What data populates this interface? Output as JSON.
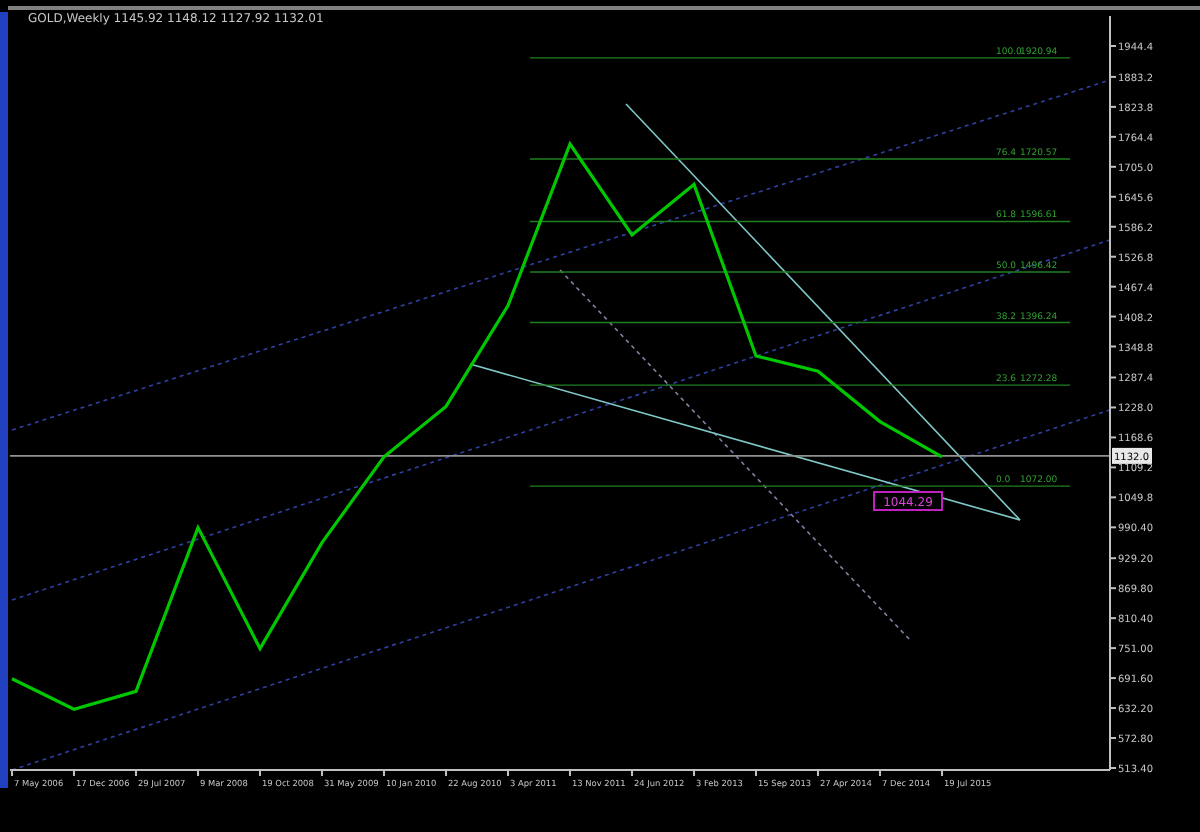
{
  "chart": {
    "title": "GOLD,Weekly  1145.92 1148.12 1127.92 1132.01",
    "price_label": "1132.0",
    "low_label": "1044.29",
    "fib_levels": [
      {
        "ratio": "100.0",
        "price": "1920.94"
      },
      {
        "ratio": "76.4",
        "price": "1720.57"
      },
      {
        "ratio": "61.8",
        "price": "1596.61"
      },
      {
        "ratio": "50.0",
        "price": "1496.42"
      },
      {
        "ratio": "38.2",
        "price": "1396.24"
      },
      {
        "ratio": "23.6",
        "price": "1272.28"
      },
      {
        "ratio": "0.0",
        "price": "1072.00"
      }
    ],
    "chart_data": {
      "type": "line",
      "categories": [
        "7 May 2006",
        "17 Dec 2006",
        "29 Jul 2007",
        "9 Mar 2008",
        "19 Oct 2008",
        "31 May 2009",
        "10 Jan 2010",
        "22 Aug 2010",
        "3 Apr 2011",
        "13 Nov 2011",
        "24 Jun 2012",
        "3 Feb 2013",
        "15 Sep 2013",
        "27 Apr 2014",
        "7 Dec 2014",
        "19 Jul 2015"
      ],
      "series": [
        {
          "color": "#00c800",
          "values": [
            690,
            630,
            665,
            990,
            750,
            960,
            1130,
            1230,
            1430,
            1750,
            1570,
            1670,
            1330,
            1300,
            1200,
            1130
          ]
        }
      ],
      "ylim": [
        509.4,
        2003.9
      ],
      "yticks": [
        {
          "value": 1944.4,
          "label": "1944.4"
        },
        {
          "value": 1883.2,
          "label": "1883.2"
        },
        {
          "value": 1823.8,
          "label": "1823.8"
        },
        {
          "value": 1764.4,
          "label": "1764.4"
        },
        {
          "value": 1705.0,
          "label": "1705.0"
        },
        {
          "value": 1645.6,
          "label": "1645.6"
        },
        {
          "value": 1586.2,
          "label": "1586.2"
        },
        {
          "value": 1526.8,
          "label": "1526.8"
        },
        {
          "value": 1467.4,
          "label": "1467.4"
        },
        {
          "value": 1408.2,
          "label": "1408.2"
        },
        {
          "value": 1348.8,
          "label": "1348.8"
        },
        {
          "value": 1287.4,
          "label": "1287.4"
        },
        {
          "value": 1228.0,
          "label": "1228.0"
        },
        {
          "value": 1168.6,
          "label": "1168.6"
        },
        {
          "value": 1109.2,
          "label": "1109.2"
        },
        {
          "value": 1049.8,
          "label": "1049.8"
        },
        {
          "value": 990.4,
          "label": "990.40"
        },
        {
          "value": 929.2,
          "label": "929.20"
        },
        {
          "value": 869.8,
          "label": "869.80"
        },
        {
          "value": 810.4,
          "label": "810.40"
        },
        {
          "value": 751.0,
          "label": "751.00"
        },
        {
          "value": 691.6,
          "label": "691.60"
        },
        {
          "value": 632.2,
          "label": "632.20"
        },
        {
          "value": 572.8,
          "label": "572.80"
        },
        {
          "value": 513.4,
          "label": "513.40"
        }
      ]
    }
  }
}
